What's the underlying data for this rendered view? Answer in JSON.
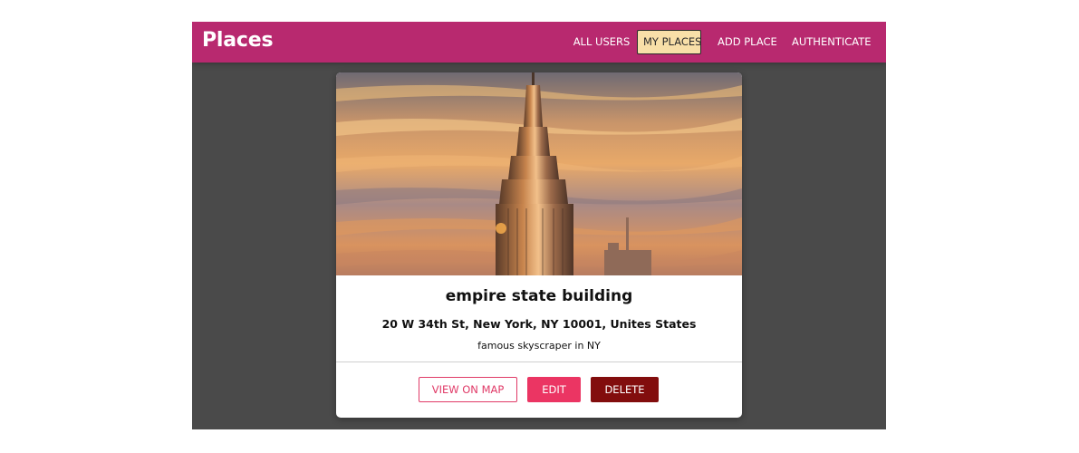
{
  "header": {
    "brand": "Places",
    "nav": [
      {
        "label": "ALL USERS",
        "active": false
      },
      {
        "label": "MY PLACES",
        "active": true
      },
      {
        "label": "ADD PLACE",
        "active": false
      },
      {
        "label": "AUTHENTICATE",
        "active": false
      }
    ]
  },
  "place": {
    "image_subject": "empire-state-building-photo",
    "title": "empire state building",
    "address": "20 W 34th St, New York, NY 10001, Unites States",
    "description": "famous skyscraper in NY"
  },
  "actions": {
    "view_on_map": "VIEW ON MAP",
    "edit": "EDIT",
    "delete": "DELETE"
  },
  "colors": {
    "header": "#b8296f",
    "background": "#4a4a4a",
    "active_nav": "#f8dfa8",
    "edit": "#eb3563",
    "delete": "#820d0d",
    "outline": "#e03a67"
  }
}
